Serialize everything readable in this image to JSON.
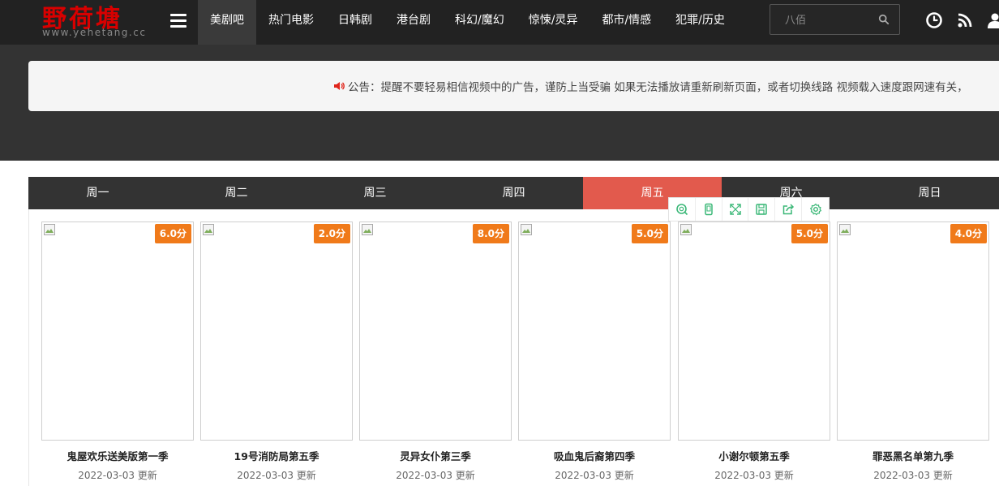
{
  "logo": {
    "text": "野荷塘",
    "url": "www.yehetang.cc"
  },
  "nav": {
    "items": [
      {
        "label": "美剧吧",
        "active": true
      },
      {
        "label": "热门电影",
        "active": false
      },
      {
        "label": "日韩剧",
        "active": false
      },
      {
        "label": "港台剧",
        "active": false
      },
      {
        "label": "科幻/魔幻",
        "active": false
      },
      {
        "label": "惊悚/灵异",
        "active": false
      },
      {
        "label": "都市/情感",
        "active": false
      },
      {
        "label": "犯罪/历史",
        "active": false
      }
    ]
  },
  "search": {
    "placeholder": "八佰"
  },
  "header_icons": [
    "clock-icon",
    "rss-icon",
    "user-icon"
  ],
  "notice": {
    "text": "公告：提醒不要轻易相信视频中的广告，谨防上当受骗 如果无法播放请重新刷新页面，或者切换线路 视频载入速度跟网速有关，"
  },
  "tabs": [
    {
      "label": "周一",
      "active": false
    },
    {
      "label": "周二",
      "active": false
    },
    {
      "label": "周三",
      "active": false
    },
    {
      "label": "周四",
      "active": false
    },
    {
      "label": "周五",
      "active": true
    },
    {
      "label": "周六",
      "active": false
    },
    {
      "label": "周日",
      "active": false
    }
  ],
  "cards": [
    {
      "title": "鬼屋欢乐送美版第一季",
      "score": "6.0分",
      "date": "2022-03-03 更新"
    },
    {
      "title": "19号消防局第五季",
      "score": "2.0分",
      "date": "2022-03-03 更新"
    },
    {
      "title": "灵异女仆第三季",
      "score": "8.0分",
      "date": "2022-03-03 更新"
    },
    {
      "title": "吸血鬼后裔第四季",
      "score": "5.0分",
      "date": "2022-03-03 更新"
    },
    {
      "title": "小谢尔顿第五季",
      "score": "5.0分",
      "date": "2022-03-03 更新"
    },
    {
      "title": "罪恶黑名单第九季",
      "score": "4.0分",
      "date": "2022-03-03 更新"
    }
  ],
  "float_toolbar": [
    "search-icon",
    "phone-icon",
    "expand-icon",
    "save-icon",
    "share-icon",
    "settings-icon"
  ],
  "colors": {
    "header_bg": "#222222",
    "band_bg": "#333333",
    "accent": "#e25a4d",
    "score_bg": "#f07a1a",
    "toolbar_green": "#3cb878"
  }
}
